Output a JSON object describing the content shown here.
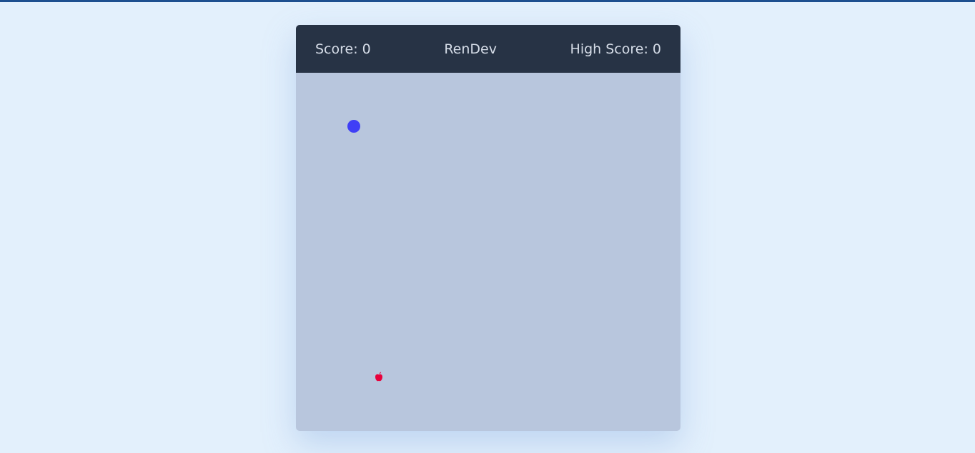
{
  "header": {
    "score_label": "Score: 0",
    "title": "RenDev",
    "high_score_label": "High Score: 0"
  },
  "game": {
    "score": 0,
    "high_score": 0,
    "snake_color": "#3f3ff6",
    "food_icon": "apple-icon",
    "food_color": "#e8003b"
  },
  "colors": {
    "page_background": "#e3f0fc",
    "top_strip": "#1d4f8f",
    "header_background": "#273345",
    "board_background": "#b8c6dd",
    "header_text": "#d6dde8"
  }
}
